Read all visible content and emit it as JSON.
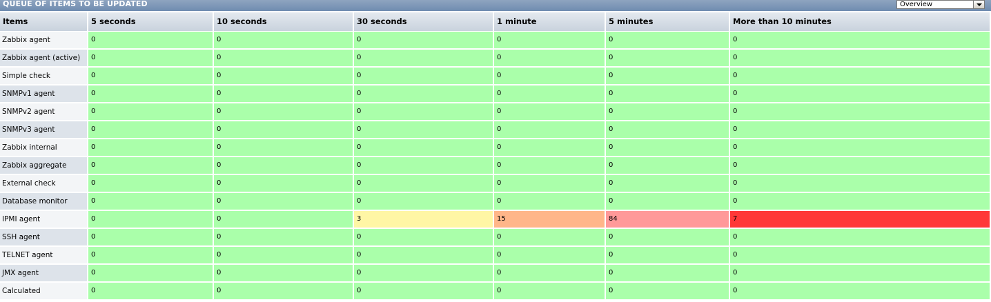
{
  "header": {
    "title": "QUEUE OF ITEMS TO BE UPDATED",
    "view_select": {
      "selected": "Overview"
    }
  },
  "table": {
    "columns": [
      "Items",
      "5 seconds",
      "10 seconds",
      "30 seconds",
      "1 minute",
      "5 minutes",
      "More than 10 minutes"
    ],
    "rows": [
      {
        "item": "Zabbix agent",
        "values": [
          "0",
          "0",
          "0",
          "0",
          "0",
          "0"
        ],
        "status": [
          "ok",
          "ok",
          "ok",
          "ok",
          "ok",
          "ok"
        ]
      },
      {
        "item": "Zabbix agent (active)",
        "values": [
          "0",
          "0",
          "0",
          "0",
          "0",
          "0"
        ],
        "status": [
          "ok",
          "ok",
          "ok",
          "ok",
          "ok",
          "ok"
        ]
      },
      {
        "item": "Simple check",
        "values": [
          "0",
          "0",
          "0",
          "0",
          "0",
          "0"
        ],
        "status": [
          "ok",
          "ok",
          "ok",
          "ok",
          "ok",
          "ok"
        ]
      },
      {
        "item": "SNMPv1 agent",
        "values": [
          "0",
          "0",
          "0",
          "0",
          "0",
          "0"
        ],
        "status": [
          "ok",
          "ok",
          "ok",
          "ok",
          "ok",
          "ok"
        ]
      },
      {
        "item": "SNMPv2 agent",
        "values": [
          "0",
          "0",
          "0",
          "0",
          "0",
          "0"
        ],
        "status": [
          "ok",
          "ok",
          "ok",
          "ok",
          "ok",
          "ok"
        ]
      },
      {
        "item": "SNMPv3 agent",
        "values": [
          "0",
          "0",
          "0",
          "0",
          "0",
          "0"
        ],
        "status": [
          "ok",
          "ok",
          "ok",
          "ok",
          "ok",
          "ok"
        ]
      },
      {
        "item": "Zabbix internal",
        "values": [
          "0",
          "0",
          "0",
          "0",
          "0",
          "0"
        ],
        "status": [
          "ok",
          "ok",
          "ok",
          "ok",
          "ok",
          "ok"
        ]
      },
      {
        "item": "Zabbix aggregate",
        "values": [
          "0",
          "0",
          "0",
          "0",
          "0",
          "0"
        ],
        "status": [
          "ok",
          "ok",
          "ok",
          "ok",
          "ok",
          "ok"
        ]
      },
      {
        "item": "External check",
        "values": [
          "0",
          "0",
          "0",
          "0",
          "0",
          "0"
        ],
        "status": [
          "ok",
          "ok",
          "ok",
          "ok",
          "ok",
          "ok"
        ]
      },
      {
        "item": "Database monitor",
        "values": [
          "0",
          "0",
          "0",
          "0",
          "0",
          "0"
        ],
        "status": [
          "ok",
          "ok",
          "ok",
          "ok",
          "ok",
          "ok"
        ]
      },
      {
        "item": "IPMI agent",
        "values": [
          "0",
          "0",
          "3",
          "15",
          "84",
          "7"
        ],
        "status": [
          "ok",
          "ok",
          "warn1",
          "warn2",
          "warn3",
          "crit"
        ]
      },
      {
        "item": "SSH agent",
        "values": [
          "0",
          "0",
          "0",
          "0",
          "0",
          "0"
        ],
        "status": [
          "ok",
          "ok",
          "ok",
          "ok",
          "ok",
          "ok"
        ]
      },
      {
        "item": "TELNET agent",
        "values": [
          "0",
          "0",
          "0",
          "0",
          "0",
          "0"
        ],
        "status": [
          "ok",
          "ok",
          "ok",
          "ok",
          "ok",
          "ok"
        ]
      },
      {
        "item": "JMX agent",
        "values": [
          "0",
          "0",
          "0",
          "0",
          "0",
          "0"
        ],
        "status": [
          "ok",
          "ok",
          "ok",
          "ok",
          "ok",
          "ok"
        ]
      },
      {
        "item": "Calculated",
        "values": [
          "0",
          "0",
          "0",
          "0",
          "0",
          "0"
        ],
        "status": [
          "ok",
          "ok",
          "ok",
          "ok",
          "ok",
          "ok"
        ]
      }
    ]
  },
  "colors": {
    "ok": "#aaffaa",
    "warn1": "#fff6a5",
    "warn2": "#ffb689",
    "warn3": "#ff9999",
    "crit": "#ff3838"
  }
}
